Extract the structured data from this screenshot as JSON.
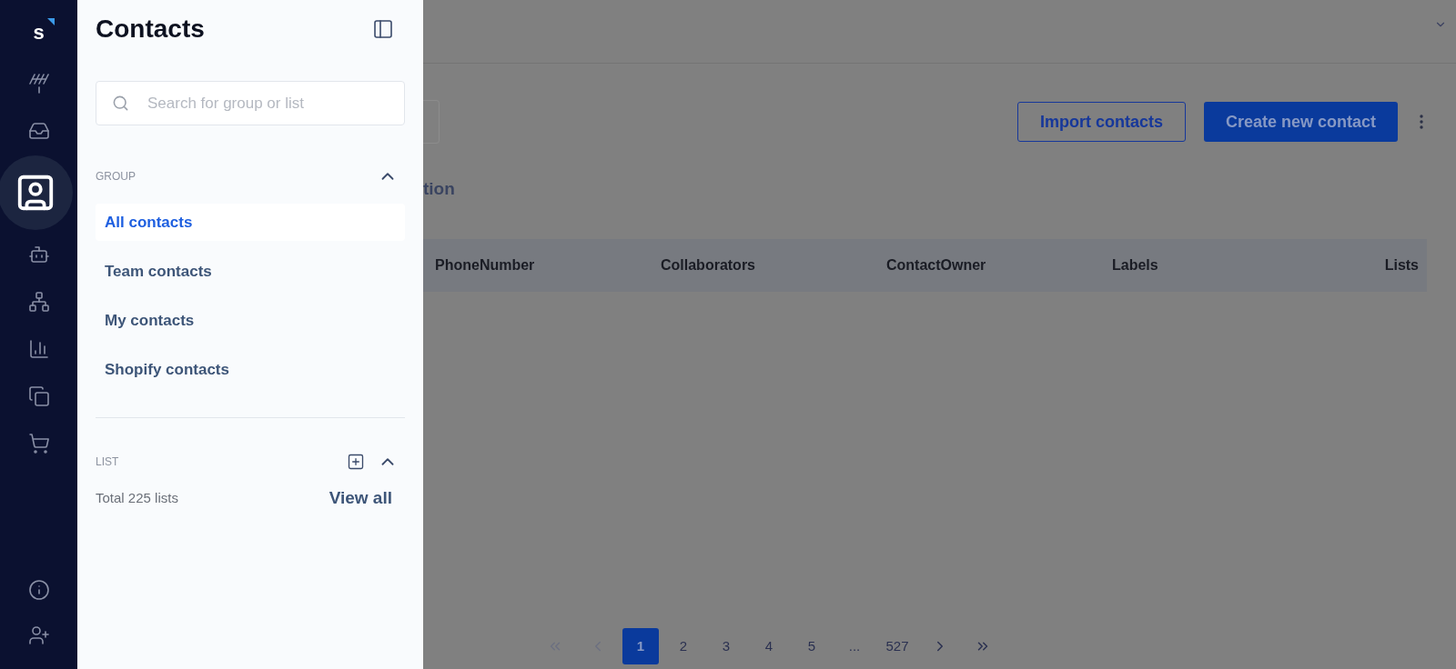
{
  "rail": {
    "logo": "s",
    "items": [
      {
        "selected": false
      },
      {
        "selected": false
      },
      {
        "selected": true
      },
      {
        "selected": false
      },
      {
        "selected": false
      },
      {
        "selected": false
      },
      {
        "selected": false
      },
      {
        "selected": false
      }
    ]
  },
  "panel": {
    "title": "Contacts",
    "search": {
      "placeholder": "Search for group or list"
    },
    "group": {
      "label": "GROUP",
      "expanded": true,
      "items": [
        {
          "label": "All contacts",
          "selected": true
        },
        {
          "label": "Team contacts",
          "selected": false
        },
        {
          "label": "My contacts",
          "selected": false
        },
        {
          "label": "Shopify contacts",
          "selected": false
        }
      ]
    },
    "list": {
      "label": "LIST",
      "expanded": true,
      "total": "Total 225 lists",
      "view_all": "View all"
    }
  },
  "main": {
    "tab_fragment": "tion",
    "buttons": [
      {
        "label": "Import contacts",
        "kind": "outline"
      },
      {
        "label": "Create new contact",
        "kind": "primary"
      }
    ],
    "table": {
      "columns": [
        "PhoneNumber",
        "Collaborators",
        "ContactOwner",
        "Labels",
        "Lists"
      ]
    },
    "pagination": {
      "pages": [
        {
          "label": "1",
          "selected": true
        },
        {
          "label": "2",
          "selected": false
        },
        {
          "label": "3",
          "selected": false
        },
        {
          "label": "4",
          "selected": false
        },
        {
          "label": "5",
          "selected": false
        },
        {
          "label": "...",
          "selected": false
        },
        {
          "label": "527",
          "selected": false
        }
      ]
    }
  }
}
